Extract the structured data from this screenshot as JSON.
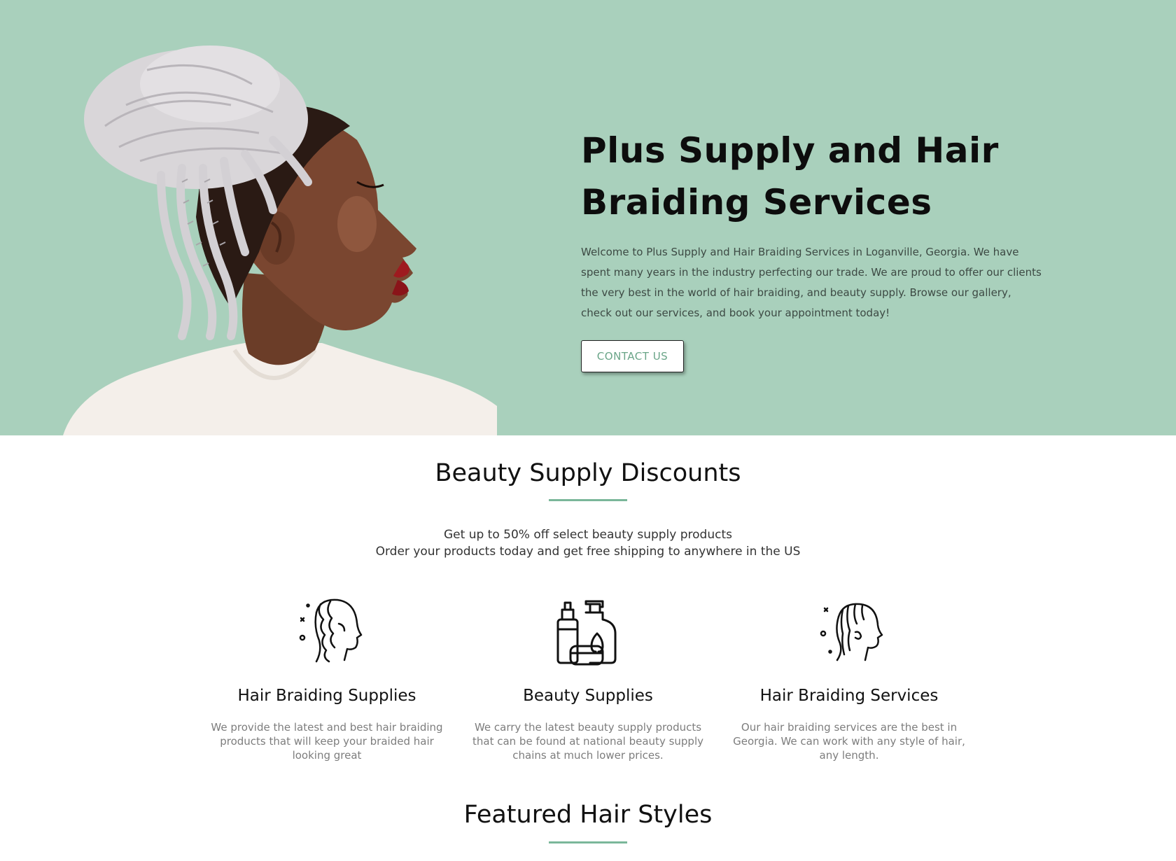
{
  "hero": {
    "title": "Plus Supply and Hair Braiding Services",
    "description": "Welcome to Plus Supply and Hair Braiding Services in Loganville, Georgia. We have spent many years in the industry perfecting our trade. We are proud to offer our clients the very best in the world of hair braiding, and beauty supply. Browse our gallery, check out our services, and book your appointment today!",
    "cta_label": "CONTACT US",
    "background_color": "#a9d0bc"
  },
  "discounts": {
    "title": "Beauty Supply Discounts",
    "line1": "Get up to 50% off select beauty supply products",
    "line2": "Order your products today and get free shipping to anywhere in the US",
    "accent_color": "#7ab79a"
  },
  "features": [
    {
      "icon": "braided-head-icon",
      "title": "Hair Braiding Supplies",
      "text": "We provide the latest and best hair braiding products that will keep your braided hair looking great"
    },
    {
      "icon": "beauty-products-icon",
      "title": "Beauty Supplies",
      "text": "We carry the latest beauty supply products that can be found at national beauty supply chains at much lower prices."
    },
    {
      "icon": "cornrows-head-icon",
      "title": "Hair Braiding Services",
      "text": "Our hair braiding services are the best in Georgia. We can work with any style of hair, any length."
    }
  ],
  "featured": {
    "title": "Featured Hair Styles"
  }
}
